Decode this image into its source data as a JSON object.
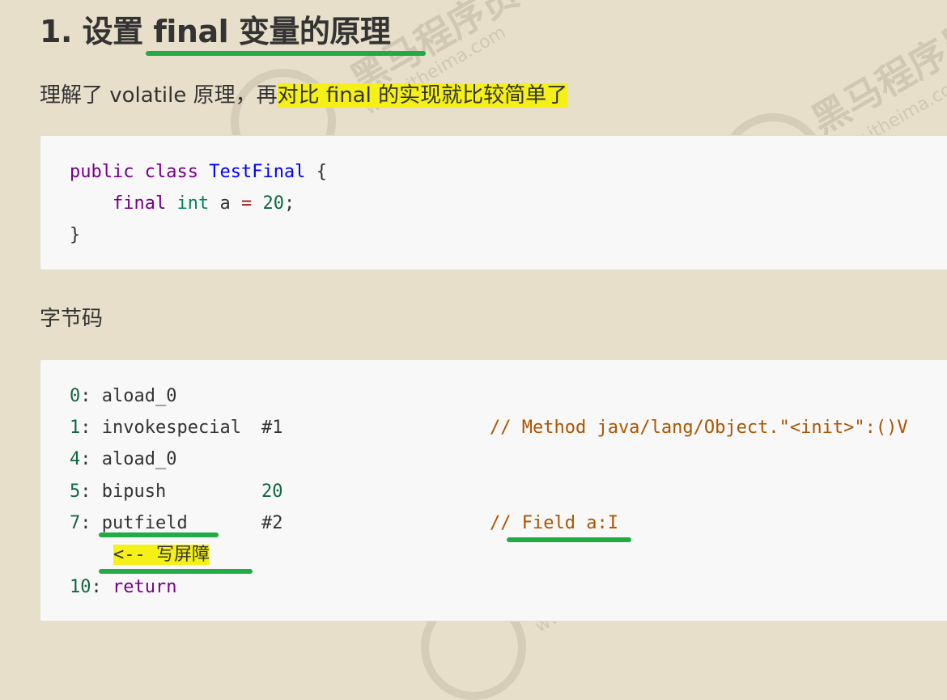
{
  "heading": "1. 设置 final 变量的原理",
  "intro": {
    "before": "理解了 volatile 原理，再",
    "highlighted": "对比 final 的实现就比较简单了"
  },
  "source_code": {
    "line1": {
      "kw1": "public",
      "kw2": "class",
      "name": "TestFinal",
      "brace": "{"
    },
    "line2": {
      "kw": "final",
      "type": "int",
      "var": "a",
      "op": "=",
      "num": "20",
      "semi": ";"
    },
    "line3": "}"
  },
  "bytecode_label": "字节码",
  "bytecode": [
    {
      "idx": "0",
      "instr": "aload_0",
      "arg": "",
      "comment": ""
    },
    {
      "idx": "1",
      "instr": "invokespecial",
      "arg": "#1",
      "comment": "// Method java/lang/Object.\"<init>\":()V"
    },
    {
      "idx": "4",
      "instr": "aload_0",
      "arg": "",
      "comment": ""
    },
    {
      "idx": "5",
      "instr": "bipush",
      "arg": "20",
      "comment": ""
    },
    {
      "idx": "7",
      "instr": "putfield",
      "arg": "#2",
      "comment": "// Field a:I"
    },
    {
      "idx": "10",
      "instr": "return",
      "arg": "",
      "comment": ""
    }
  ],
  "annotation": {
    "arrow": "<--",
    "text": "写屏障"
  },
  "watermark": {
    "brand": "黑马程序员",
    "site": "www.itheima.com"
  }
}
